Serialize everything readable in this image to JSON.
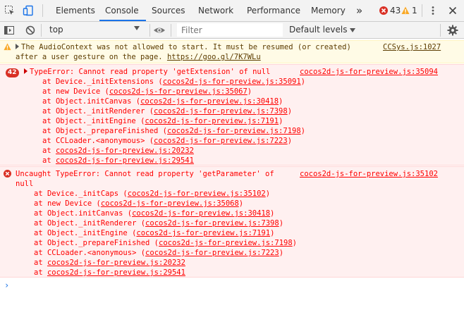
{
  "tabs": {
    "items": [
      {
        "label": "Elements"
      },
      {
        "label": "Console"
      },
      {
        "label": "Sources"
      },
      {
        "label": "Network"
      },
      {
        "label": "Performance"
      },
      {
        "label": "Memory"
      }
    ],
    "more": "»",
    "error_count": "43",
    "warning_count": "1"
  },
  "toolbar": {
    "context": "top",
    "filter_placeholder": "Filter",
    "levels_label": "Default levels"
  },
  "warning": {
    "line1": "The AudioContext was not allowed to start. It must be resumed (or created)",
    "line2_prefix": "after a user gesture on the page. ",
    "line2_link": "https://goo.gl/7K7WLu",
    "source": "CCSys.js:1027"
  },
  "error1": {
    "count": "42",
    "message": "TypeError: Cannot read property 'getExtension' of null",
    "source": "cocos2d-js-for-preview.js:35094",
    "stack": [
      {
        "prefix": "at Device._initExtensions (",
        "link": "cocos2d-js-for-preview.js:35091",
        "suffix": ")"
      },
      {
        "prefix": "at new Device (",
        "link": "cocos2d-js-for-preview.js:35067",
        "suffix": ")"
      },
      {
        "prefix": "at Object.initCanvas (",
        "link": "cocos2d-js-for-preview.js:30418",
        "suffix": ")"
      },
      {
        "prefix": "at Object._initRenderer (",
        "link": "cocos2d-js-for-preview.js:7398",
        "suffix": ")"
      },
      {
        "prefix": "at Object._initEngine (",
        "link": "cocos2d-js-for-preview.js:7191",
        "suffix": ")"
      },
      {
        "prefix": "at Object._prepareFinished (",
        "link": "cocos2d-js-for-preview.js:7198",
        "suffix": ")"
      },
      {
        "prefix": "at CCLoader.<anonymous> (",
        "link": "cocos2d-js-for-preview.js:7223",
        "suffix": ")"
      },
      {
        "prefix": "at ",
        "link": "cocos2d-js-for-preview.js:20232",
        "suffix": ""
      },
      {
        "prefix": "at ",
        "link": "cocos2d-js-for-preview.js:29541",
        "suffix": ""
      }
    ]
  },
  "error2": {
    "message_line1": "Uncaught TypeError: Cannot read property 'getParameter' of",
    "message_line2": "null",
    "source": "cocos2d-js-for-preview.js:35102",
    "stack": [
      {
        "prefix": "at Device._initCaps (",
        "link": "cocos2d-js-for-preview.js:35102",
        "suffix": ")"
      },
      {
        "prefix": "at new Device (",
        "link": "cocos2d-js-for-preview.js:35068",
        "suffix": ")"
      },
      {
        "prefix": "at Object.initCanvas (",
        "link": "cocos2d-js-for-preview.js:30418",
        "suffix": ")"
      },
      {
        "prefix": "at Object._initRenderer (",
        "link": "cocos2d-js-for-preview.js:7398",
        "suffix": ")"
      },
      {
        "prefix": "at Object._initEngine (",
        "link": "cocos2d-js-for-preview.js:7191",
        "suffix": ")"
      },
      {
        "prefix": "at Object._prepareFinished (",
        "link": "cocos2d-js-for-preview.js:7198",
        "suffix": ")"
      },
      {
        "prefix": "at CCLoader.<anonymous> (",
        "link": "cocos2d-js-for-preview.js:7223",
        "suffix": ")"
      },
      {
        "prefix": "at ",
        "link": "cocos2d-js-for-preview.js:20232",
        "suffix": ""
      },
      {
        "prefix": "at ",
        "link": "cocos2d-js-for-preview.js:29541",
        "suffix": ""
      }
    ]
  },
  "prompt": "›",
  "icons": {
    "inspect": "inspect-element-icon",
    "device": "device-toolbar-icon",
    "sidebar": "show-sidebar-icon",
    "clear": "clear-console-icon",
    "eye": "live-expression-icon",
    "kebab": "more-options-icon",
    "close": "close-icon",
    "gear": "gear-icon"
  },
  "colors": {
    "accent": "#1a73e8",
    "error": "#d93025",
    "warning": "#f9a825"
  }
}
